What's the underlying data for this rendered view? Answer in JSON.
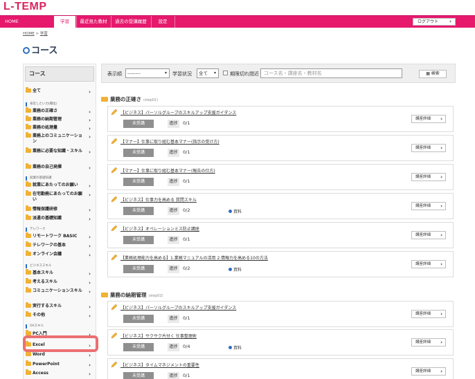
{
  "app": {
    "logo": "L-TEMP"
  },
  "nav": {
    "items": [
      {
        "label": "HOME"
      },
      {
        "label": "学習"
      },
      {
        "label": "最近見た教材"
      },
      {
        "label": "過去の受講履歴"
      },
      {
        "label": "設定"
      }
    ],
    "logout": "ログアウト"
  },
  "breadcrumb": {
    "home": "HOME",
    "sep": ">",
    "current": "学習"
  },
  "page": {
    "title": "コース"
  },
  "sidebar": {
    "heading": "コース",
    "all_label": "全て",
    "categories": [
      {
        "name": "身近したい力(職位)",
        "items": [
          "業務の正確さ",
          "業務の納期管理",
          "業務の処理量",
          "業務上のコミュニケーション",
          "業務に必要な知識・スキル",
          "業務の自己発揮"
        ]
      },
      {
        "name": "就業の基礎知識",
        "items": [
          "就業にあたってのお願い",
          "在宅勤務にあたってのお願い",
          "情報保護研修",
          "派遣の基礎知識"
        ]
      },
      {
        "name": "テレワーク",
        "items": [
          "リモートワーク BASIC",
          "テレワークの基本",
          "オンライン会議"
        ]
      },
      {
        "name": "ビジネススキル",
        "items": [
          "基本スキル",
          "考えるスキル",
          "コミュニケーションスキル",
          "実行するスキル",
          "その他"
        ]
      },
      {
        "name": "OAスキル",
        "items": [
          "PC入門",
          "Excel",
          "Word",
          "PowerPoint",
          "Access"
        ]
      }
    ]
  },
  "filter": {
    "sort_label": "表示順",
    "sort_value": "--------",
    "status_label": "学習状況",
    "status_value": "全て",
    "deadline_label": "期限切れ間近",
    "search_placeholder": "コース名・講座名・教材名",
    "search_button": "検索"
  },
  "sections": [
    {
      "title": "業務の正確さ",
      "step": "(step01)",
      "courses": [
        {
          "title": "【ビジネス】パーソルグループのスキルアップ支援ガイダンス",
          "status": "未受講",
          "progress_label": "進捗",
          "progress": "0/1",
          "material": ""
        },
        {
          "title": "【マナー】仕事に取り組む基本マナー(指示の受け方)",
          "status": "未受講",
          "progress_label": "進捗",
          "progress": "0/1",
          "material": ""
        },
        {
          "title": "【マナー】仕事に取り組む基本マナー(報告の仕方)",
          "status": "未受講",
          "progress_label": "進捗",
          "progress": "0/1",
          "material": ""
        },
        {
          "title": "【ビジネス】仕事力を高める 質問スキル",
          "status": "未受講",
          "progress_label": "進捗",
          "progress": "0/2",
          "material": "資料"
        },
        {
          "title": "【ビジネス】オペレーションミス防止講座",
          "status": "未受講",
          "progress_label": "進捗",
          "progress": "0/1",
          "material": ""
        },
        {
          "title": "【業務処理能力を高める】1.業務マニュアルの活用 2.情報力を高める10の方法",
          "status": "未受講",
          "progress_label": "進捗",
          "progress": "0/2",
          "material": "資料"
        }
      ]
    },
    {
      "title": "業務の納期管理",
      "step": "(step02)",
      "courses": [
        {
          "title": "【ビジネス】パーソルグループのスキルアップ支援ガイダンス",
          "status": "未受講",
          "progress_label": "進捗",
          "progress": "0/1",
          "material": ""
        },
        {
          "title": "【ビジネス】サクサク片付く 仕事整理術",
          "status": "未受講",
          "progress_label": "進捗",
          "progress": "0/4",
          "material": "資料"
        },
        {
          "title": "【ビジネス】タイムマネジメントの重要性",
          "status": "未受講",
          "progress_label": "進捗",
          "progress": "0/1",
          "material": ""
        }
      ]
    }
  ],
  "detail_label": "講座詳細",
  "colors": {
    "brand": "#e6196d",
    "status_bg": "#8f8f8f",
    "highlight": "#ec6f72",
    "folder": "#f1b133"
  }
}
